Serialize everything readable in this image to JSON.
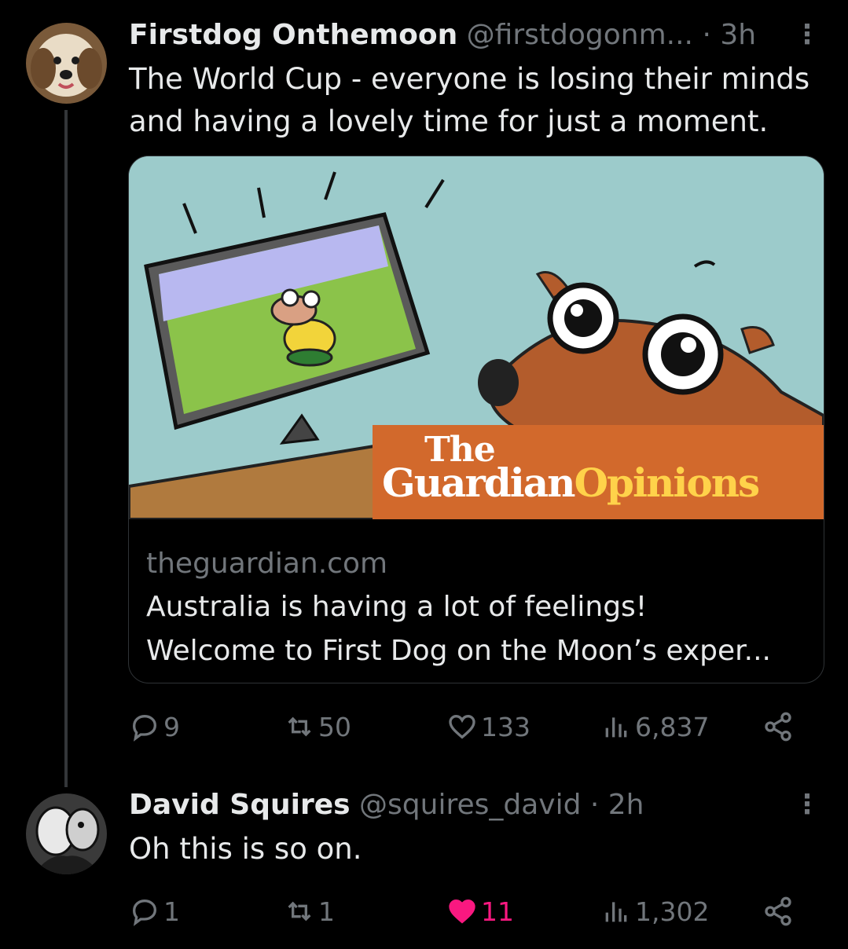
{
  "tweet1": {
    "display_name": "Firstdog Onthemoon",
    "handle": "@firstdogonm...",
    "time": "· 3h",
    "more": "⋮",
    "text": "The World Cup - everyone is losing their minds and having a lovely time for just a moment.",
    "card": {
      "banner_the": "The",
      "banner_guardian": "Guardian",
      "banner_opinions": "Opinions",
      "domain": "theguardian.com",
      "title_line1": "Australia is having a lot of feelings!",
      "title_line2": "Welcome to First Dog on the Moon’s exper..."
    },
    "stats": {
      "replies": "9",
      "reposts": "50",
      "likes": "133",
      "views": "6,837"
    }
  },
  "tweet2": {
    "display_name": "David Squires",
    "handle": "@squires_david",
    "time": "· 2h",
    "more": "⋮",
    "text": "Oh this is so on.",
    "stats": {
      "replies": "1",
      "reposts": "1",
      "likes": "11",
      "views": "1,302"
    },
    "liked": true
  },
  "colors": {
    "background": "#000000",
    "text": "#e7e9ea",
    "secondary": "#71767b",
    "like_active": "#f91880",
    "guardian_orange": "#d2692c",
    "guardian_yellow": "#ffd24a"
  },
  "icons": [
    "reply-icon",
    "repost-icon",
    "like-icon",
    "views-icon",
    "share-icon",
    "more-icon"
  ]
}
